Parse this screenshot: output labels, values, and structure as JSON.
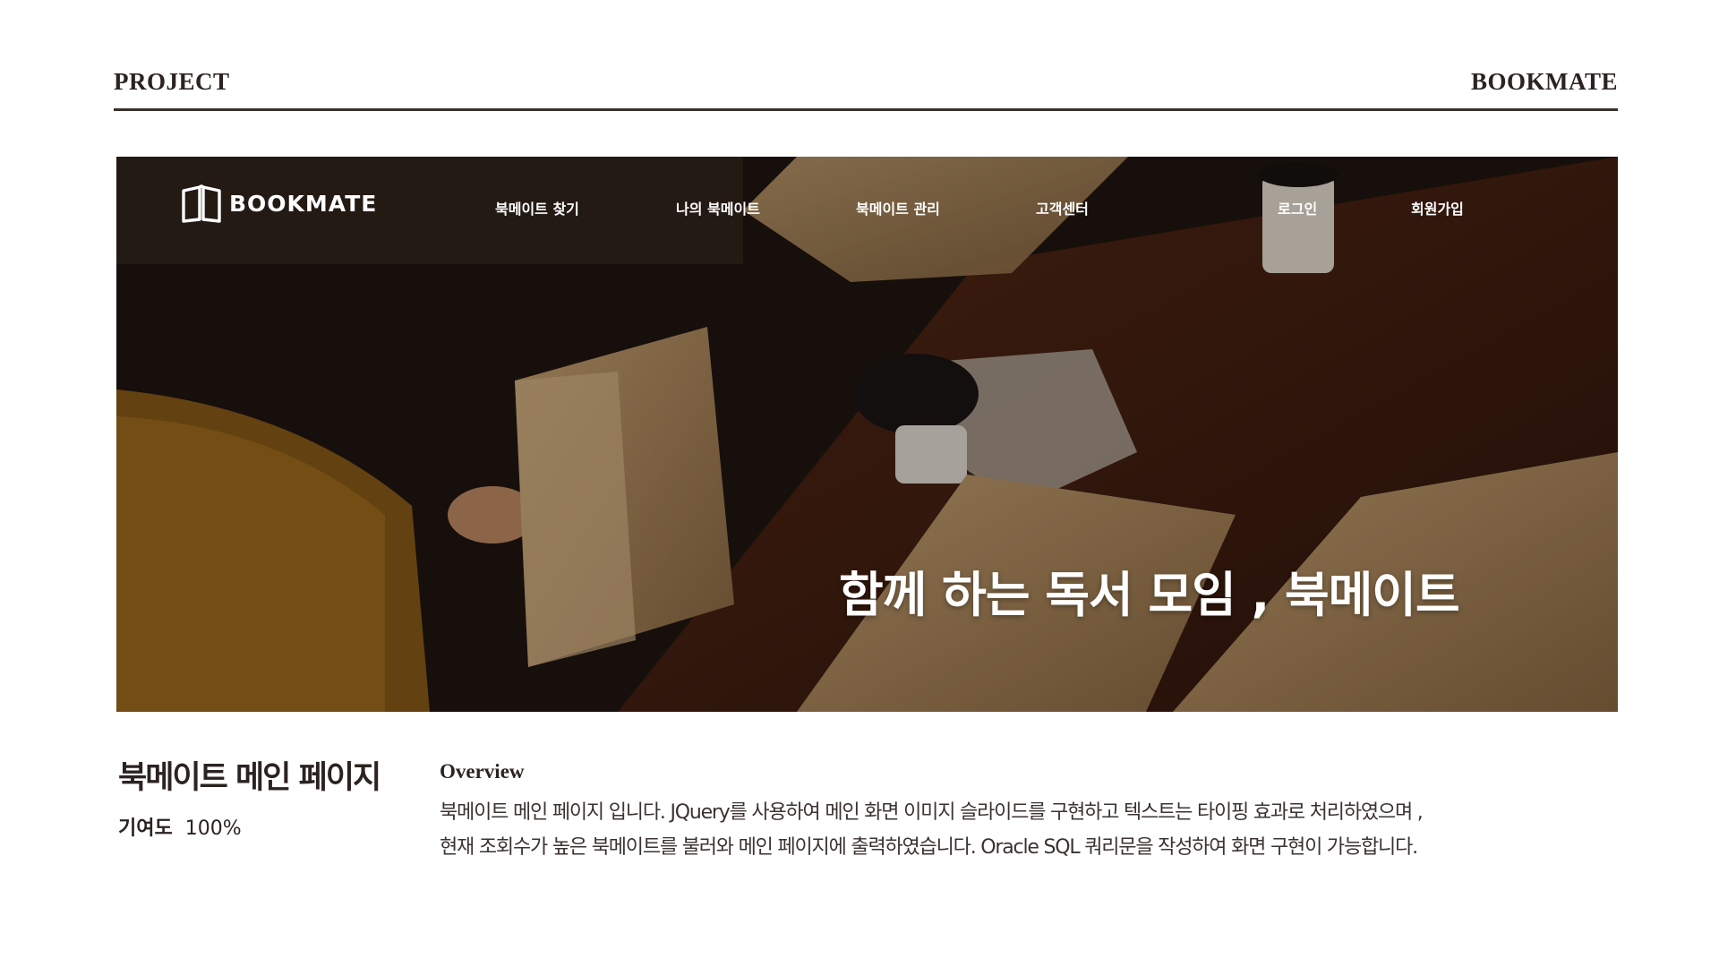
{
  "header": {
    "left_label": "PROJECT",
    "right_label": "BOOKMATE"
  },
  "hero": {
    "logo_text": "BOOKMATE",
    "logo_icon": "open-book-icon",
    "nav": [
      "북메이트 찾기",
      "나의 북메이트",
      "북메이트 관리",
      "고객센터",
      "로그인",
      "회원가입"
    ],
    "slogan": "함께 하는 독서 모임 , 북메이트"
  },
  "project": {
    "title": "북메이트 메인 페이지",
    "contribution_label": "기여도",
    "contribution_value": "100%"
  },
  "overview": {
    "heading": "Overview",
    "lines": [
      "북메이트 메인 페이지 입니다.  JQuery를 사용하여 메인 화면 이미지 슬라이드를 구현하고 텍스트는 타이핑 효과로 처리하였으며 ,",
      "현재 조회수가 높은 북메이트를 불러와 메인 페이지에 출력하였습니다. Oracle SQL 쿼리문을 작성하여 화면 구현이 가능합니다."
    ]
  }
}
